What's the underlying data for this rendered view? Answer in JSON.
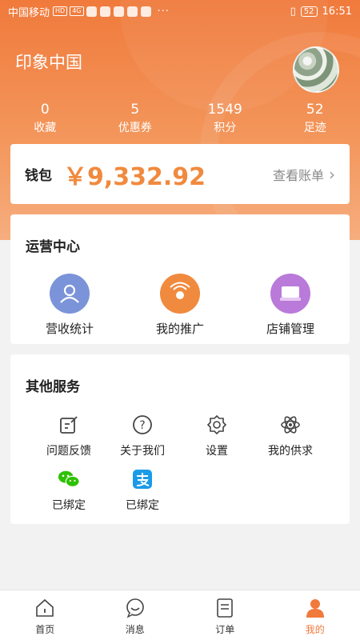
{
  "status_bar": {
    "carrier": "中国移动",
    "hd": "HD",
    "signal": "4G",
    "battery": "52",
    "time": "16:51"
  },
  "profile": {
    "shop_name": "印象中国"
  },
  "stats": [
    {
      "value": "0",
      "label": "收藏"
    },
    {
      "value": "5",
      "label": "优惠券"
    },
    {
      "value": "1549",
      "label": "积分"
    },
    {
      "value": "52",
      "label": "足迹"
    }
  ],
  "wallet": {
    "title": "钱包",
    "amount": "￥9,332.92",
    "link": "查看账单"
  },
  "operations": {
    "title": "运营中心",
    "items": [
      {
        "label": "营收统计",
        "icon": "revenue-icon"
      },
      {
        "label": "我的推广",
        "icon": "promotion-icon"
      },
      {
        "label": "店铺管理",
        "icon": "store-icon"
      }
    ]
  },
  "other_services": {
    "title": "其他服务",
    "items": [
      {
        "label": "问题反馈",
        "icon": "feedback-icon"
      },
      {
        "label": "关于我们",
        "icon": "help-icon"
      },
      {
        "label": "设置",
        "icon": "gear-icon"
      },
      {
        "label": "我的供求",
        "icon": "atom-icon"
      },
      {
        "label": "已绑定",
        "icon": "wechat-icon"
      },
      {
        "label": "已绑定",
        "icon": "alipay-icon"
      }
    ]
  },
  "tabbar": {
    "items": [
      {
        "label": "首页",
        "icon": "home-icon"
      },
      {
        "label": "消息",
        "icon": "message-icon"
      },
      {
        "label": "订单",
        "icon": "order-icon"
      },
      {
        "label": "我的",
        "icon": "user-icon"
      }
    ]
  },
  "colors": {
    "accent": "#f07a3c",
    "amount": "#f08a3e",
    "revenue_icon": "#7b93d8",
    "promotion_icon": "#f08a3e",
    "store_icon": "#b97ad9",
    "wechat": "#2dc100",
    "alipay": "#1a9be8"
  }
}
